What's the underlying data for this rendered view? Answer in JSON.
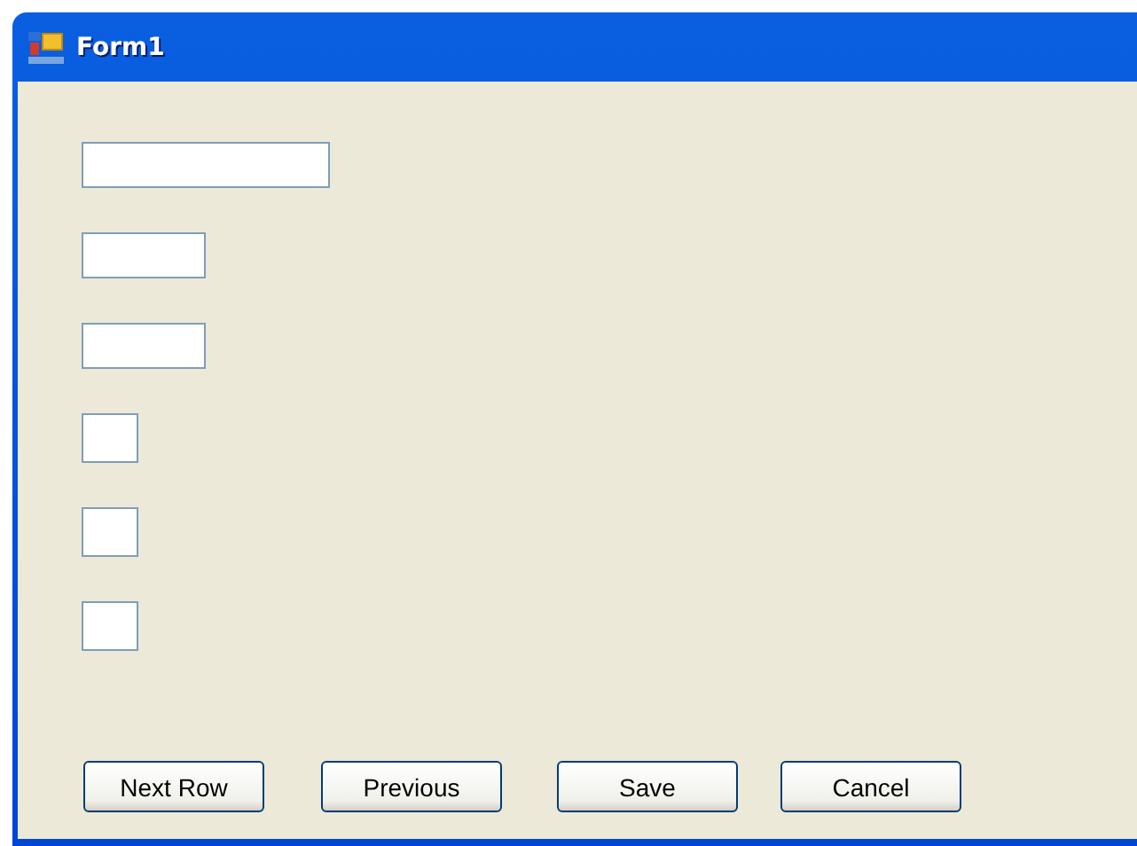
{
  "window": {
    "title": "Form1"
  },
  "fields": [
    {
      "kind": "wide"
    },
    {
      "kind": "medium"
    },
    {
      "kind": "medium"
    },
    {
      "kind": "small"
    },
    {
      "kind": "small"
    },
    {
      "kind": "small"
    }
  ],
  "buttons": [
    "Next Row",
    "Previous",
    "Save",
    "Cancel"
  ]
}
